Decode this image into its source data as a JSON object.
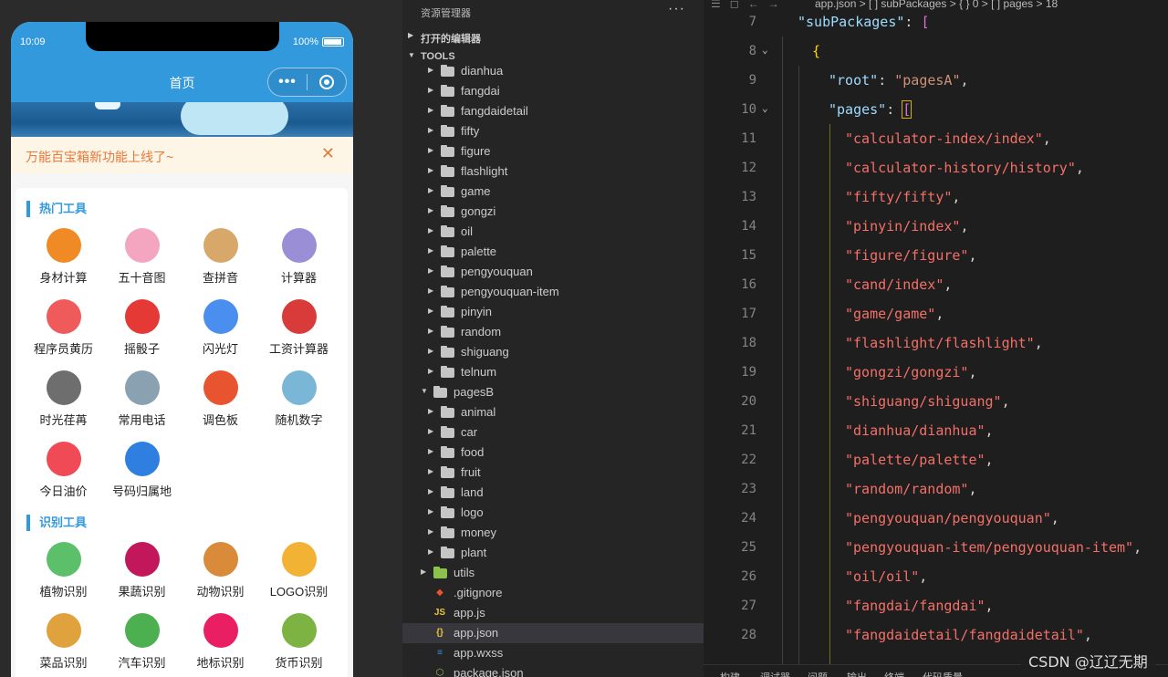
{
  "phone": {
    "status": {
      "time": "10:09",
      "battery": "100%"
    },
    "nav_title": "首页",
    "notice": "万能百宝箱新功能上线了~",
    "sections": [
      {
        "title": "热门工具",
        "tools": [
          {
            "label": "身材计算",
            "icon": "scale-icon",
            "color": "#f08a24"
          },
          {
            "label": "五十音图",
            "icon": "sakura-icon",
            "color": "#f4a6c1"
          },
          {
            "label": "查拼音",
            "icon": "dictionary-icon",
            "color": "#d8a86a"
          },
          {
            "label": "计算器",
            "icon": "calculator-icon",
            "color": "#9a8fd6"
          },
          {
            "label": "程序员黄历",
            "icon": "calendar-icon",
            "color": "#ef5a5a"
          },
          {
            "label": "摇骰子",
            "icon": "dice-icon",
            "color": "#e53935"
          },
          {
            "label": "闪光灯",
            "icon": "flashlight-icon",
            "color": "#4a8ef0"
          },
          {
            "label": "工资计算器",
            "icon": "wallet-icon",
            "color": "#d93a3a"
          },
          {
            "label": "时光荏苒",
            "icon": "clock-icon",
            "color": "#6e6e6e"
          },
          {
            "label": "常用电话",
            "icon": "phone-icon",
            "color": "#8aa1b1"
          },
          {
            "label": "调色板",
            "icon": "palette-icon",
            "color": "#e8542f"
          },
          {
            "label": "随机数字",
            "icon": "random-icon",
            "color": "#7ab6d6"
          },
          {
            "label": "今日油价",
            "icon": "fuel-icon",
            "color": "#ef4a55"
          },
          {
            "label": "号码归属地",
            "icon": "sim-icon",
            "color": "#2f7fe0"
          }
        ]
      },
      {
        "title": "识别工具",
        "tools": [
          {
            "label": "植物识别",
            "icon": "plant-icon",
            "color": "#5cbf6a"
          },
          {
            "label": "果蔬识别",
            "icon": "vegetable-icon",
            "color": "#c2185b"
          },
          {
            "label": "动物识别",
            "icon": "monkey-icon",
            "color": "#d98b3a"
          },
          {
            "label": "LOGO识别",
            "icon": "shopping-bag-icon",
            "color": "#f2b233"
          },
          {
            "label": "菜品识别",
            "icon": "dish-icon",
            "color": "#e0a23c"
          },
          {
            "label": "汽车识别",
            "icon": "car-icon",
            "color": "#4caf50"
          },
          {
            "label": "地标识别",
            "icon": "pagoda-icon",
            "color": "#e91e63"
          },
          {
            "label": "货币识别",
            "icon": "money-icon",
            "color": "#7cb342"
          }
        ]
      }
    ]
  },
  "explorer": {
    "header": "资源管理器",
    "more": "···",
    "open_editors": "打开的编辑器",
    "root": "TOOLS",
    "rows": [
      {
        "name": "dianhua",
        "type": "folder",
        "depth": 2,
        "expanded": false
      },
      {
        "name": "fangdai",
        "type": "folder",
        "depth": 2,
        "expanded": false
      },
      {
        "name": "fangdaidetail",
        "type": "folder",
        "depth": 2,
        "expanded": false
      },
      {
        "name": "fifty",
        "type": "folder",
        "depth": 2,
        "expanded": false
      },
      {
        "name": "figure",
        "type": "folder",
        "depth": 2,
        "expanded": false
      },
      {
        "name": "flashlight",
        "type": "folder",
        "depth": 2,
        "expanded": false
      },
      {
        "name": "game",
        "type": "folder",
        "depth": 2,
        "expanded": false
      },
      {
        "name": "gongzi",
        "type": "folder",
        "depth": 2,
        "expanded": false
      },
      {
        "name": "oil",
        "type": "folder",
        "depth": 2,
        "expanded": false
      },
      {
        "name": "palette",
        "type": "folder",
        "depth": 2,
        "expanded": false
      },
      {
        "name": "pengyouquan",
        "type": "folder",
        "depth": 2,
        "expanded": false
      },
      {
        "name": "pengyouquan-item",
        "type": "folder",
        "depth": 2,
        "expanded": false
      },
      {
        "name": "pinyin",
        "type": "folder",
        "depth": 2,
        "expanded": false
      },
      {
        "name": "random",
        "type": "folder",
        "depth": 2,
        "expanded": false
      },
      {
        "name": "shiguang",
        "type": "folder",
        "depth": 2,
        "expanded": false
      },
      {
        "name": "telnum",
        "type": "folder",
        "depth": 2,
        "expanded": false
      },
      {
        "name": "pagesB",
        "type": "folder",
        "depth": 1,
        "expanded": true
      },
      {
        "name": "animal",
        "type": "folder",
        "depth": 2,
        "expanded": false
      },
      {
        "name": "car",
        "type": "folder",
        "depth": 2,
        "expanded": false
      },
      {
        "name": "food",
        "type": "folder",
        "depth": 2,
        "expanded": false
      },
      {
        "name": "fruit",
        "type": "folder",
        "depth": 2,
        "expanded": false
      },
      {
        "name": "land",
        "type": "folder",
        "depth": 2,
        "expanded": false
      },
      {
        "name": "logo",
        "type": "folder",
        "depth": 2,
        "expanded": false
      },
      {
        "name": "money",
        "type": "folder",
        "depth": 2,
        "expanded": false
      },
      {
        "name": "plant",
        "type": "folder",
        "depth": 2,
        "expanded": false
      },
      {
        "name": "utils",
        "type": "folder-green",
        "depth": 1,
        "expanded": false
      },
      {
        "name": ".gitignore",
        "type": "git",
        "depth": 1
      },
      {
        "name": "app.js",
        "type": "js",
        "depth": 1
      },
      {
        "name": "app.json",
        "type": "json",
        "depth": 1,
        "selected": true
      },
      {
        "name": "app.wxss",
        "type": "css",
        "depth": 1
      },
      {
        "name": "package.json",
        "type": "npm",
        "depth": 1
      }
    ]
  },
  "editor": {
    "breadcrumb": "app.json > [ ] subPackages > { } 0 > [ ] pages > 18",
    "lines": [
      {
        "n": "7",
        "key": "\"subPackages\"",
        "after": ": ",
        "open": "[",
        "indent": 0
      },
      {
        "n": "8",
        "open": "{",
        "indent": 1
      },
      {
        "n": "9",
        "key": "\"root\"",
        "after": ": ",
        "val": "\"pagesA\"",
        "tail": ",",
        "indent": 2
      },
      {
        "n": "10",
        "key": "\"pages\"",
        "after": ": ",
        "open": "[",
        "indent": 2,
        "cursor": true
      },
      {
        "n": "11",
        "val": "\"calculator-index/index\"",
        "tail": ",",
        "indent": 3
      },
      {
        "n": "12",
        "val": "\"calculator-history/history\"",
        "tail": ",",
        "indent": 3
      },
      {
        "n": "13",
        "val": "\"fifty/fifty\"",
        "tail": ",",
        "indent": 3
      },
      {
        "n": "14",
        "val": "\"pinyin/index\"",
        "tail": ",",
        "indent": 3
      },
      {
        "n": "15",
        "val": "\"figure/figure\"",
        "tail": ",",
        "indent": 3
      },
      {
        "n": "16",
        "val": "\"cand/index\"",
        "tail": ",",
        "indent": 3
      },
      {
        "n": "17",
        "val": "\"game/game\"",
        "tail": ",",
        "indent": 3
      },
      {
        "n": "18",
        "val": "\"flashlight/flashlight\"",
        "tail": ",",
        "indent": 3
      },
      {
        "n": "19",
        "val": "\"gongzi/gongzi\"",
        "tail": ",",
        "indent": 3
      },
      {
        "n": "20",
        "val": "\"shiguang/shiguang\"",
        "tail": ",",
        "indent": 3
      },
      {
        "n": "21",
        "val": "\"dianhua/dianhua\"",
        "tail": ",",
        "indent": 3
      },
      {
        "n": "22",
        "val": "\"palette/palette\"",
        "tail": ",",
        "indent": 3
      },
      {
        "n": "23",
        "val": "\"random/random\"",
        "tail": ",",
        "indent": 3
      },
      {
        "n": "24",
        "val": "\"pengyouquan/pengyouquan\"",
        "tail": ",",
        "indent": 3
      },
      {
        "n": "25",
        "val": "\"pengyouquan-item/pengyouquan-item\"",
        "tail": ",",
        "indent": 3
      },
      {
        "n": "26",
        "val": "\"oil/oil\"",
        "tail": ",",
        "indent": 3
      },
      {
        "n": "27",
        "val": "\"fangdai/fangdai\"",
        "tail": ",",
        "indent": 3
      },
      {
        "n": "28",
        "val": "\"fangdaidetail/fangdaidetail\"",
        "tail": ",",
        "indent": 3
      }
    ],
    "bottom_tabs": [
      "构建",
      "调试器",
      "问题",
      "输出",
      "终端",
      "代码质量"
    ]
  },
  "watermark": "CSDN @辽辽无期"
}
